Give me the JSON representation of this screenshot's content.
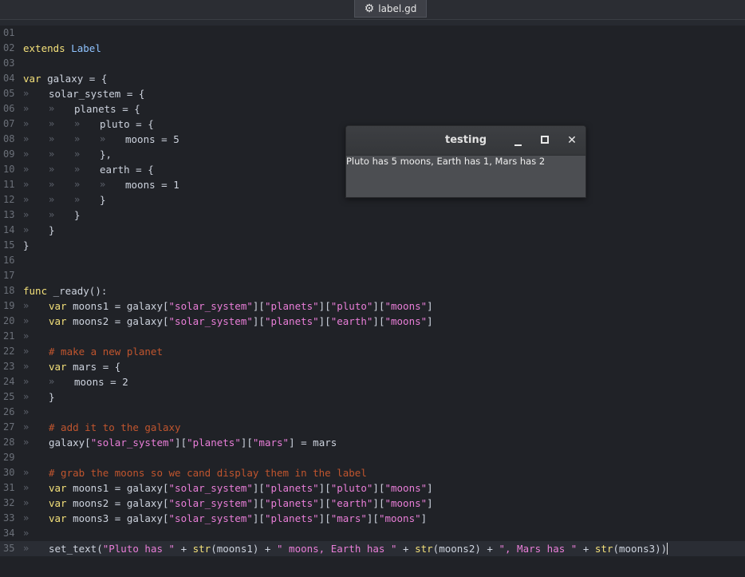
{
  "tab": {
    "icon": "gear-icon",
    "label": "label.gd"
  },
  "editor": {
    "tab_mark": "»",
    "lines": [
      {
        "n": "01",
        "tabs": 0,
        "tokens": []
      },
      {
        "n": "02",
        "tabs": 0,
        "tokens": [
          [
            "kw",
            "extends"
          ],
          [
            "t",
            " "
          ],
          [
            "ty",
            "Label"
          ]
        ]
      },
      {
        "n": "03",
        "tabs": 0,
        "tokens": []
      },
      {
        "n": "04",
        "tabs": 0,
        "tokens": [
          [
            "kw",
            "var"
          ],
          [
            "t",
            " galaxy = {"
          ]
        ]
      },
      {
        "n": "05",
        "tabs": 1,
        "tokens": [
          [
            "t",
            "solar_system = {"
          ]
        ]
      },
      {
        "n": "06",
        "tabs": 2,
        "tokens": [
          [
            "t",
            "planets = {"
          ]
        ]
      },
      {
        "n": "07",
        "tabs": 3,
        "tokens": [
          [
            "t",
            "pluto = {"
          ]
        ]
      },
      {
        "n": "08",
        "tabs": 4,
        "tokens": [
          [
            "t",
            "moons = 5"
          ]
        ]
      },
      {
        "n": "09",
        "tabs": 3,
        "tokens": [
          [
            "t",
            "},"
          ]
        ]
      },
      {
        "n": "10",
        "tabs": 3,
        "tokens": [
          [
            "t",
            "earth = {"
          ]
        ]
      },
      {
        "n": "11",
        "tabs": 4,
        "tokens": [
          [
            "t",
            "moons = 1"
          ]
        ]
      },
      {
        "n": "12",
        "tabs": 3,
        "tokens": [
          [
            "t",
            "}"
          ]
        ]
      },
      {
        "n": "13",
        "tabs": 2,
        "tokens": [
          [
            "t",
            "}"
          ]
        ]
      },
      {
        "n": "14",
        "tabs": 1,
        "tokens": [
          [
            "t",
            "}"
          ]
        ]
      },
      {
        "n": "15",
        "tabs": 0,
        "tokens": [
          [
            "t",
            "}"
          ]
        ]
      },
      {
        "n": "16",
        "tabs": 0,
        "tokens": []
      },
      {
        "n": "17",
        "tabs": 0,
        "tokens": []
      },
      {
        "n": "18",
        "tabs": 0,
        "tokens": [
          [
            "kw",
            "func"
          ],
          [
            "t",
            " _ready():"
          ]
        ]
      },
      {
        "n": "19",
        "tabs": 1,
        "tokens": [
          [
            "kw",
            "var"
          ],
          [
            "t",
            " moons1 = galaxy["
          ],
          [
            "str",
            "\"solar_system\""
          ],
          [
            "t",
            "]["
          ],
          [
            "str",
            "\"planets\""
          ],
          [
            "t",
            "]["
          ],
          [
            "str",
            "\"pluto\""
          ],
          [
            "t",
            "]["
          ],
          [
            "str",
            "\"moons\""
          ],
          [
            "t",
            "]"
          ]
        ]
      },
      {
        "n": "20",
        "tabs": 1,
        "tokens": [
          [
            "kw",
            "var"
          ],
          [
            "t",
            " moons2 = galaxy["
          ],
          [
            "str",
            "\"solar_system\""
          ],
          [
            "t",
            "]["
          ],
          [
            "str",
            "\"planets\""
          ],
          [
            "t",
            "]["
          ],
          [
            "str",
            "\"earth\""
          ],
          [
            "t",
            "]["
          ],
          [
            "str",
            "\"moons\""
          ],
          [
            "t",
            "]"
          ]
        ]
      },
      {
        "n": "21",
        "tabs": 1,
        "tokens": []
      },
      {
        "n": "22",
        "tabs": 1,
        "tokens": [
          [
            "com",
            "# make a new planet"
          ]
        ]
      },
      {
        "n": "23",
        "tabs": 1,
        "tokens": [
          [
            "kw",
            "var"
          ],
          [
            "t",
            " mars = {"
          ]
        ]
      },
      {
        "n": "24",
        "tabs": 2,
        "tokens": [
          [
            "t",
            "moons = 2"
          ]
        ]
      },
      {
        "n": "25",
        "tabs": 1,
        "tokens": [
          [
            "t",
            "}"
          ]
        ]
      },
      {
        "n": "26",
        "tabs": 1,
        "tokens": []
      },
      {
        "n": "27",
        "tabs": 1,
        "tokens": [
          [
            "com",
            "# add it to the galaxy"
          ]
        ]
      },
      {
        "n": "28",
        "tabs": 1,
        "tokens": [
          [
            "t",
            "galaxy["
          ],
          [
            "str",
            "\"solar_system\""
          ],
          [
            "t",
            "]["
          ],
          [
            "str",
            "\"planets\""
          ],
          [
            "t",
            "]["
          ],
          [
            "str",
            "\"mars\""
          ],
          [
            "t",
            "] = mars"
          ]
        ]
      },
      {
        "n": "29",
        "tabs": 0,
        "tokens": []
      },
      {
        "n": "30",
        "tabs": 1,
        "tokens": [
          [
            "com",
            "# grab the moons so we cand display them in the label"
          ]
        ]
      },
      {
        "n": "31",
        "tabs": 1,
        "tokens": [
          [
            "kw",
            "var"
          ],
          [
            "t",
            " moons1 = galaxy["
          ],
          [
            "str",
            "\"solar_system\""
          ],
          [
            "t",
            "]["
          ],
          [
            "str",
            "\"planets\""
          ],
          [
            "t",
            "]["
          ],
          [
            "str",
            "\"pluto\""
          ],
          [
            "t",
            "]["
          ],
          [
            "str",
            "\"moons\""
          ],
          [
            "t",
            "]"
          ]
        ]
      },
      {
        "n": "32",
        "tabs": 1,
        "tokens": [
          [
            "kw",
            "var"
          ],
          [
            "t",
            " moons2 = galaxy["
          ],
          [
            "str",
            "\"solar_system\""
          ],
          [
            "t",
            "]["
          ],
          [
            "str",
            "\"planets\""
          ],
          [
            "t",
            "]["
          ],
          [
            "str",
            "\"earth\""
          ],
          [
            "t",
            "]["
          ],
          [
            "str",
            "\"moons\""
          ],
          [
            "t",
            "]"
          ]
        ]
      },
      {
        "n": "33",
        "tabs": 1,
        "tokens": [
          [
            "kw",
            "var"
          ],
          [
            "t",
            " moons3 = galaxy["
          ],
          [
            "str",
            "\"solar_system\""
          ],
          [
            "t",
            "]["
          ],
          [
            "str",
            "\"planets\""
          ],
          [
            "t",
            "]["
          ],
          [
            "str",
            "\"mars\""
          ],
          [
            "t",
            "]["
          ],
          [
            "str",
            "\"moons\""
          ],
          [
            "t",
            "]"
          ]
        ]
      },
      {
        "n": "34",
        "tabs": 1,
        "tokens": []
      },
      {
        "n": "35",
        "tabs": 1,
        "current": true,
        "tokens": [
          [
            "t",
            "set_text("
          ],
          [
            "str",
            "\"Pluto has \""
          ],
          [
            "t",
            " + "
          ],
          [
            "kw",
            "str"
          ],
          [
            "t",
            "(moons1) + "
          ],
          [
            "str",
            "\" moons, Earth has \""
          ],
          [
            "t",
            " + "
          ],
          [
            "kw",
            "str"
          ],
          [
            "t",
            "(moons2) + "
          ],
          [
            "str",
            "\", Mars has \""
          ],
          [
            "t",
            " + "
          ],
          [
            "kw",
            "str"
          ],
          [
            "t",
            "(moons3))"
          ]
        ]
      }
    ]
  },
  "window": {
    "title": "testing",
    "minimize_icon": "minimize-icon",
    "maximize_icon": "maximize-icon",
    "close_icon": "close-icon",
    "label": "Pluto has 5 moons, Earth has 1, Mars has 2"
  }
}
